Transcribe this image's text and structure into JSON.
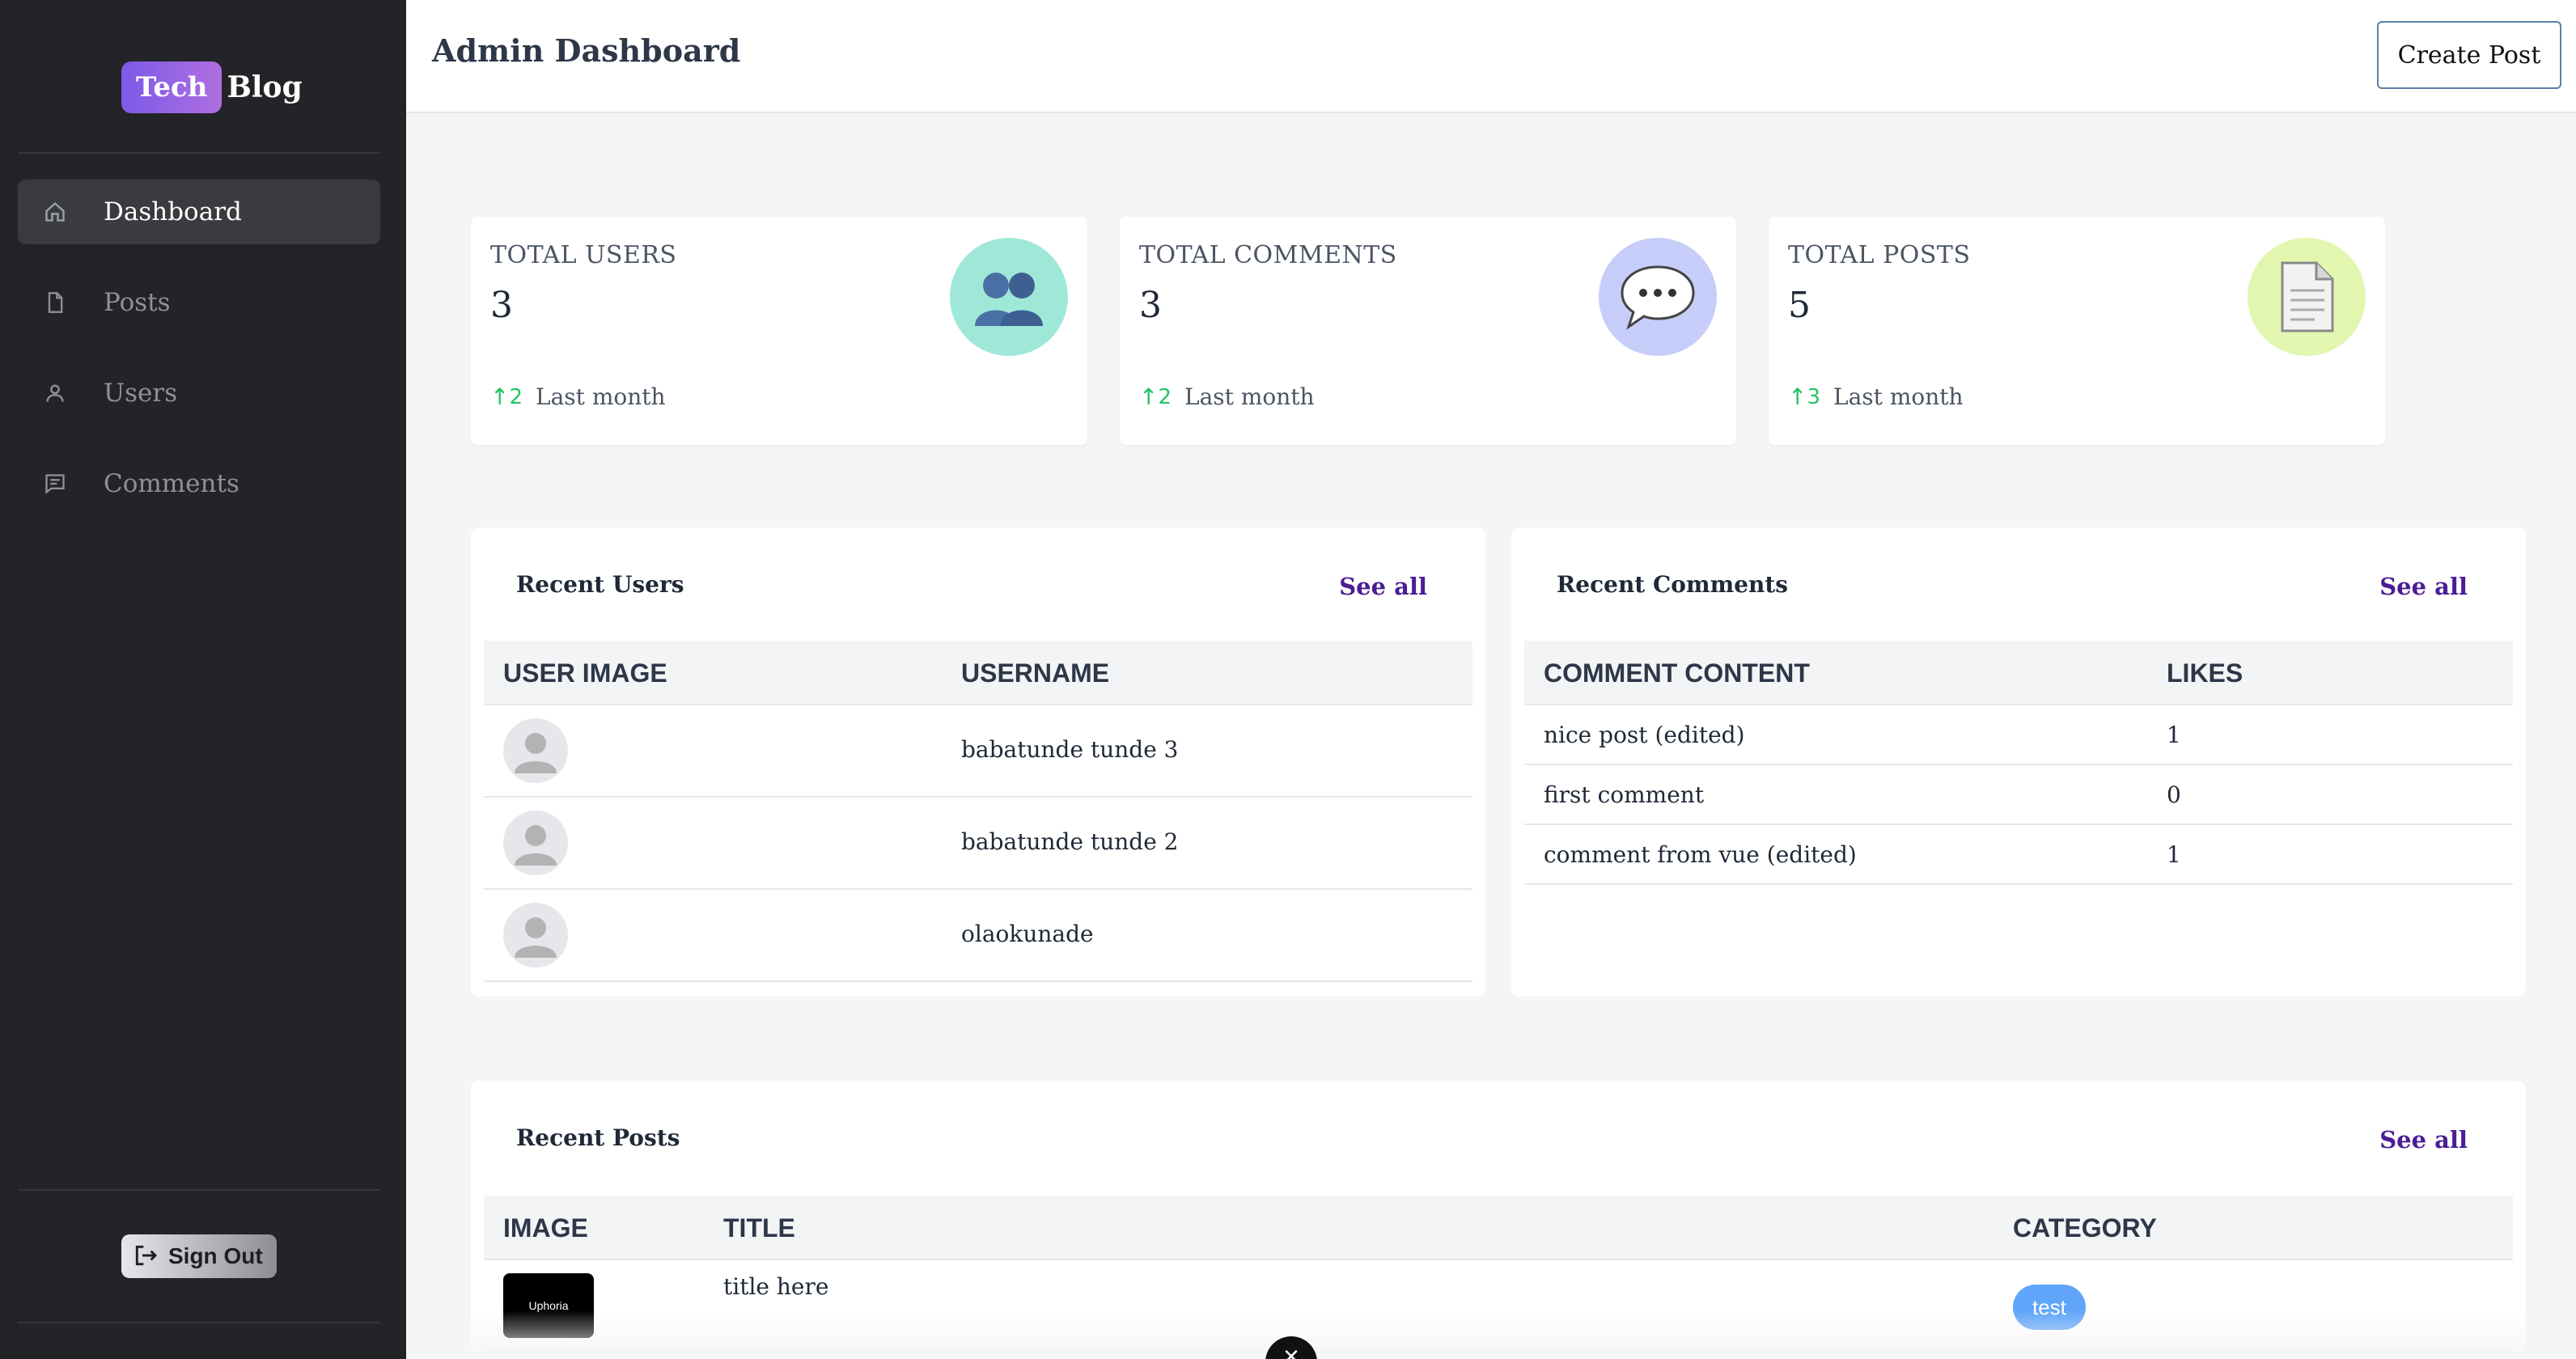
{
  "sidebar": {
    "brand_tech": "Tech",
    "brand_blog": "Blog",
    "items": [
      {
        "label": "Dashboard",
        "icon": "home-icon",
        "active": true
      },
      {
        "label": "Posts",
        "icon": "document-icon",
        "active": false
      },
      {
        "label": "Users",
        "icon": "user-icon",
        "active": false
      },
      {
        "label": "Comments",
        "icon": "comment-icon",
        "active": false
      }
    ],
    "signout_label": "Sign Out"
  },
  "header": {
    "title": "Admin Dashboard",
    "create_post_label": "Create Post"
  },
  "stats": [
    {
      "title": "TOTAL USERS",
      "value": "3",
      "trend": "2",
      "trend_label": "Last month",
      "icon": "users-icon",
      "icon_bg": "#9fe8d8"
    },
    {
      "title": "TOTAL COMMENTS",
      "value": "3",
      "trend": "2",
      "trend_label": "Last month",
      "icon": "speech-bubble-icon",
      "icon_bg": "#c7cdf9"
    },
    {
      "title": "TOTAL POSTS",
      "value": "5",
      "trend": "3",
      "trend_label": "Last month",
      "icon": "document-icon",
      "icon_bg": "#e2f6b0"
    }
  ],
  "recent_users": {
    "title": "Recent Users",
    "see_all": "See all",
    "columns": [
      "USER IMAGE",
      "USERNAME"
    ],
    "rows": [
      {
        "username": "babatunde tunde 3"
      },
      {
        "username": "babatunde tunde 2"
      },
      {
        "username": "olaokunade"
      }
    ]
  },
  "recent_comments": {
    "title": "Recent Comments",
    "see_all": "See all",
    "columns": [
      "COMMENT CONTENT",
      "LIKES"
    ],
    "rows": [
      {
        "content": "nice post (edited)",
        "likes": "1"
      },
      {
        "content": "first comment",
        "likes": "0"
      },
      {
        "content": "comment from vue (edited)",
        "likes": "1"
      }
    ]
  },
  "recent_posts": {
    "title": "Recent Posts",
    "see_all": "See all",
    "columns": [
      "IMAGE",
      "TITLE",
      "CATEGORY"
    ],
    "rows": [
      {
        "image_text": "Uphoria",
        "title": "title here",
        "category": "test"
      }
    ]
  },
  "colors": {
    "sidebar_bg": "#232427",
    "accent_link": "#4c1d95",
    "trend_up": "#22c55e",
    "badge": "#60a5fa"
  }
}
